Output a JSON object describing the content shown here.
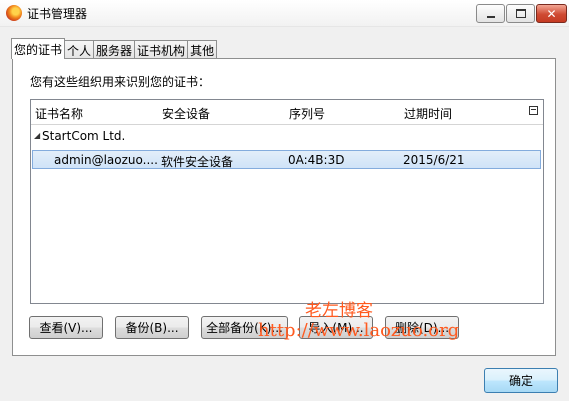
{
  "window": {
    "title": "证书管理器"
  },
  "tabs": [
    {
      "label": "您的证书",
      "active": true
    },
    {
      "label": "个人",
      "active": false
    },
    {
      "label": "服务器",
      "active": false
    },
    {
      "label": "证书机构",
      "active": false
    },
    {
      "label": "其他",
      "active": false
    }
  ],
  "prompt": "您有这些组织用来识别您的证书：",
  "table": {
    "columns": [
      "证书名称",
      "安全设备",
      "序列号",
      "过期时间"
    ],
    "group": "StartCom Ltd.",
    "rows": [
      {
        "name": "admin@laozuo....",
        "device": "软件安全设备",
        "serial": "0A:4B:3D",
        "expires": "2015/6/21"
      }
    ]
  },
  "buttons": {
    "view": "查看(V)...",
    "backup": "备份(B)...",
    "backup_all": "全部备份(K)...",
    "import": "导入(M)...",
    "delete": "删除(D)..."
  },
  "ok": "确定",
  "watermark": {
    "line1": "老左博客",
    "line2": "http://www.laozuo.org"
  }
}
